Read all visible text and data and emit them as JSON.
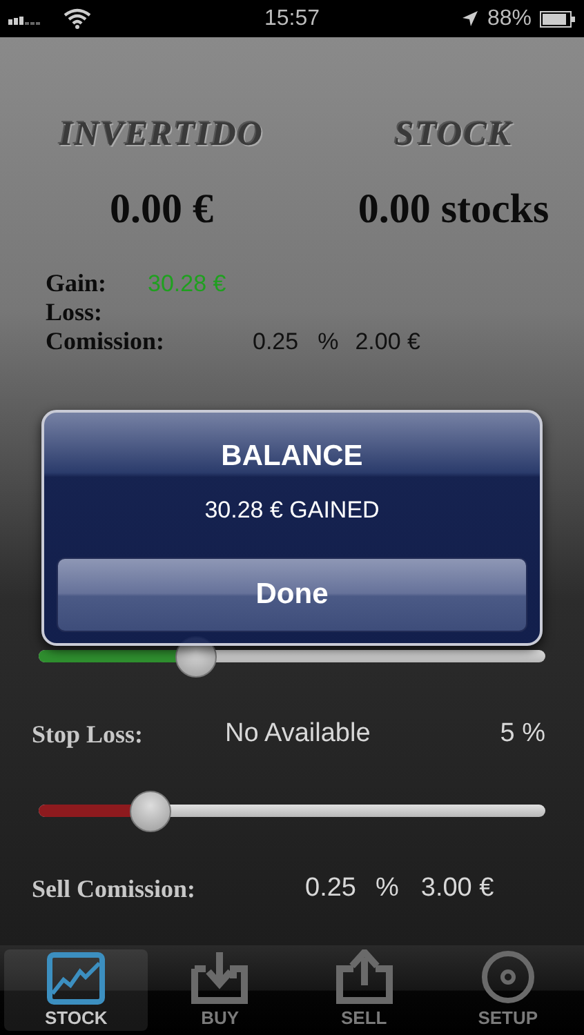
{
  "status_bar": {
    "time": "15:57",
    "battery": "88%"
  },
  "summary": [
    {
      "title": "INVERTIDO",
      "value": "0.00 €"
    },
    {
      "title": "STOCK",
      "value": "0.00 stocks"
    }
  ],
  "details": [
    {
      "kind": "gain",
      "label": "Gain:",
      "value": "30.28 €"
    },
    {
      "kind": "plain",
      "label": "Loss:"
    },
    {
      "kind": "commission",
      "label": "Comission:",
      "percent": "0.25",
      "unit": "%",
      "amount": "2.00 €"
    }
  ],
  "settings": [
    {
      "kind": "slider",
      "level": 0.31,
      "color": "#2f8f2f"
    },
    {
      "kind": "text",
      "label": "Stop Loss:",
      "status": "No Available",
      "percent": "5  %"
    },
    {
      "kind": "slider",
      "level": 0.22,
      "color": "#8e1a1e"
    },
    {
      "kind": "commission",
      "label": "Sell Comission:",
      "percent": "0.25",
      "unit": "%",
      "amount": "3.00 €"
    }
  ],
  "alert": {
    "title": "BALANCE",
    "message": "30.28 € GAINED",
    "button": "Done"
  },
  "tabs": [
    {
      "kind": "chart",
      "label": "STOCK",
      "selected": true
    },
    {
      "kind": "download",
      "label": "BUY",
      "selected": false
    },
    {
      "kind": "upload",
      "label": "SELL",
      "selected": false
    },
    {
      "kind": "gear",
      "label": "SETUP",
      "selected": false
    }
  ]
}
